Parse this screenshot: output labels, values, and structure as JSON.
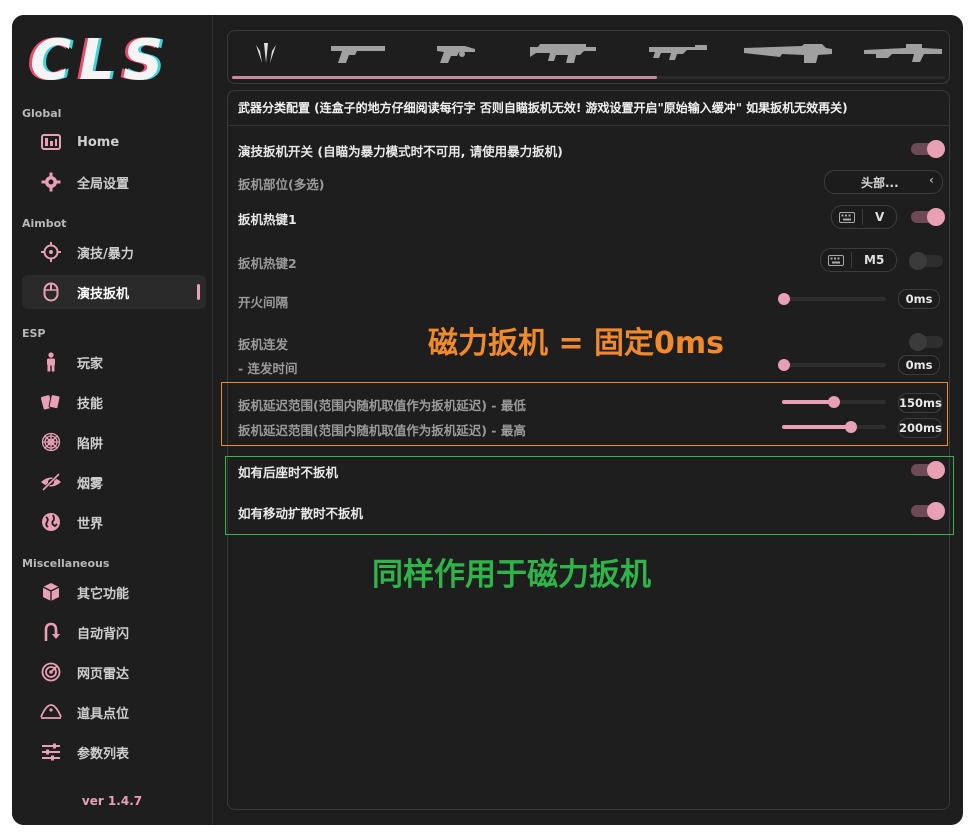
{
  "app": {
    "logo_text": "CLS",
    "version": "ver 1.4.7",
    "accent_color": "#e8a0b4"
  },
  "sidebar": {
    "sections": [
      {
        "title": "Global",
        "items": [
          {
            "label": "Home",
            "icon": "dashboard-icon"
          },
          {
            "label": "全局设置",
            "icon": "gear-icon"
          }
        ]
      },
      {
        "title": "Aimbot",
        "items": [
          {
            "label": "演技/暴力",
            "icon": "crosshair-icon"
          },
          {
            "label": "演技扳机",
            "icon": "mouse-icon",
            "active": true
          }
        ]
      },
      {
        "title": "ESP",
        "items": [
          {
            "label": "玩家",
            "icon": "person-icon"
          },
          {
            "label": "技能",
            "icon": "cards-icon"
          },
          {
            "label": "陷阱",
            "icon": "spider-web-icon"
          },
          {
            "label": "烟雾",
            "icon": "eye-off-icon"
          },
          {
            "label": "世界",
            "icon": "globe-icon"
          }
        ]
      },
      {
        "title": "Miscellaneous",
        "items": [
          {
            "label": "其它功能",
            "icon": "cube-icon"
          },
          {
            "label": "自动背闪",
            "icon": "u-turn-icon"
          },
          {
            "label": "网页雷达",
            "icon": "radar-icon"
          },
          {
            "label": "道具点位",
            "icon": "map-pin-icon"
          },
          {
            "label": "参数列表",
            "icon": "sliders-icon"
          }
        ]
      }
    ]
  },
  "weapon_tabs": [
    "claw-icon",
    "pistol-icon",
    "revolver-icon",
    "smg-icon",
    "rifle-icon",
    "shotgun-icon",
    "sniper-icon"
  ],
  "panel": {
    "header": "武器分类配置 (连盒子的地方仔细阅读每行字 否则自瞄扳机无效! 游戏设置开启\"原始输入缓冲\" 如果扳机无效再关)",
    "rows": {
      "trigger_switch": {
        "label": "演技扳机开关 (自瞄为暴力模式时不可用, 请使用暴力扳机)",
        "enabled": true
      },
      "trigger_bone": {
        "label": "扳机部位(多选)",
        "value": "头部...",
        "chevron": "‹"
      },
      "hotkey1": {
        "label": "扳机热键1",
        "key": "V",
        "enabled": true
      },
      "hotkey2": {
        "label": "扳机热键2",
        "key": "M5",
        "enabled": false
      },
      "fire_interval": {
        "label": "开火间隔",
        "value_text": "0ms",
        "value": 0
      },
      "burst": {
        "label": "扳机连发",
        "enabled": false
      },
      "burst_time": {
        "label": "- 连发时间",
        "value_text": "0ms",
        "value": 0
      },
      "delay_min": {
        "label": "扳机延迟范围(范围内随机取值作为扳机延迟) - 最低",
        "value_text": "150ms",
        "fraction": 0.5
      },
      "delay_max": {
        "label": "扳机延迟范围(范围内随机取值作为扳机延迟) - 最高",
        "value_text": "200ms",
        "fraction": 0.66
      },
      "no_recoil": {
        "label": "如有后座时不扳机",
        "enabled": true
      },
      "no_spread": {
        "label": "如有移动扩散时不扳机",
        "enabled": true
      }
    }
  },
  "annotations": {
    "orange_text": "磁力扳机 = 固定0ms",
    "orange_color": "#f08a2c",
    "green_text": "同样作用于磁力扳机",
    "green_color": "#2fb44a"
  }
}
